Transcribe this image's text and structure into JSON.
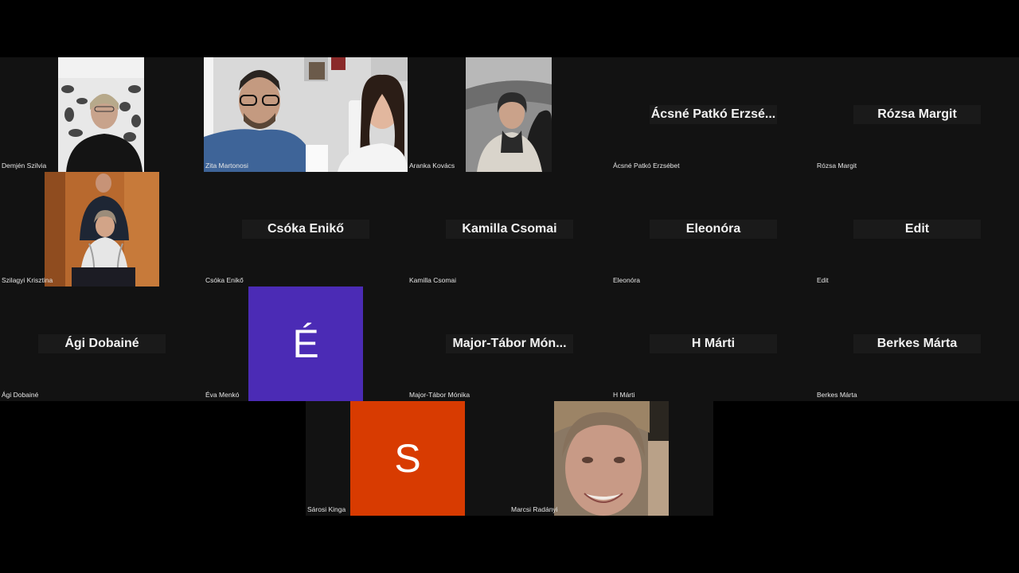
{
  "meeting": {
    "row1": [
      {
        "name": "Demjén Szilvia"
      },
      {
        "name": "Zita Martonosi"
      },
      {
        "name": "Aranka Kovács"
      },
      {
        "name": "Ácsné Patkó Erzsébet",
        "display": "Ácsné  Patkó  Erzsé..."
      },
      {
        "name": "Rózsa Margit",
        "display": "Rózsa Margit"
      }
    ],
    "row2": [
      {
        "name": "Szilagyi Krisztina"
      },
      {
        "name": "Csóka Enikő",
        "display": "Csóka Enikő"
      },
      {
        "name": "Kamilla Csomai",
        "display": "Kamilla Csomai"
      },
      {
        "name": "Eleonóra",
        "display": "Eleonóra"
      },
      {
        "name": "Edit",
        "display": "Edit"
      }
    ],
    "row3": [
      {
        "name": "Ági Dobainé",
        "display": "Ági Dobainé"
      },
      {
        "name": "Éva Menkó",
        "avatar_letter": "É",
        "avatar_color": "#4b2bb5"
      },
      {
        "name": "Major-Tábor Mónika",
        "display": "Major-Tábor  Món..."
      },
      {
        "name": "H Márti",
        "display": "H Márti"
      },
      {
        "name": "Berkes Márta",
        "display": "Berkes Márta"
      }
    ],
    "row4": [
      {
        "name": "Sárosi Kinga",
        "avatar_letter": "S",
        "avatar_color": "#d83b01"
      },
      {
        "name": "Marcsi Radányi"
      }
    ]
  }
}
